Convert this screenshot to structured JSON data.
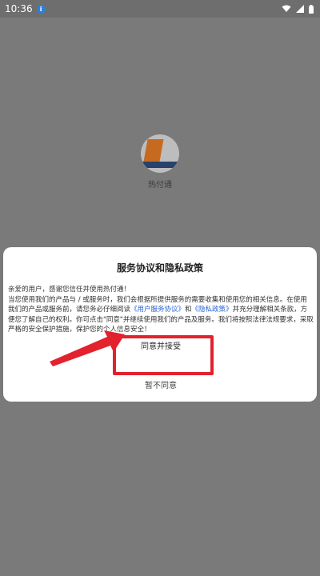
{
  "status_bar": {
    "time": "10:36",
    "info_badge": "i",
    "icons": [
      "info-icon",
      "wifi-icon",
      "signal-icon",
      "battery-icon"
    ]
  },
  "splash": {
    "app_name": "热付通"
  },
  "dialog": {
    "title": "服务协议和隐私政策",
    "greeting": "亲爱的用户，感谢您信任并使用热付通！",
    "paragraph_1": "当您使用我们的产品与 / 或服务时，我们会根据所提供服务的需要收集和使用您的相关信息。在使用我们的产品或服务前，请您务必仔细阅读",
    "link_user_agreement": "《用户服务协议》",
    "and": "和",
    "link_privacy": "《隐私政策》",
    "paragraph_2": "并充分理解相关条款，方便您了解自己的权利。你可点击\"同意\"并继续使用我们的产品及服务。我们将按照法律法规要求，采取严格的安全保护措施，保护您的个人信息安全！",
    "agree_label": "同意并接受",
    "decline_label": "暂不同意"
  },
  "colors": {
    "link": "#2a64d8",
    "highlight": "#e2222d",
    "overlay": "#7a7a7a"
  }
}
